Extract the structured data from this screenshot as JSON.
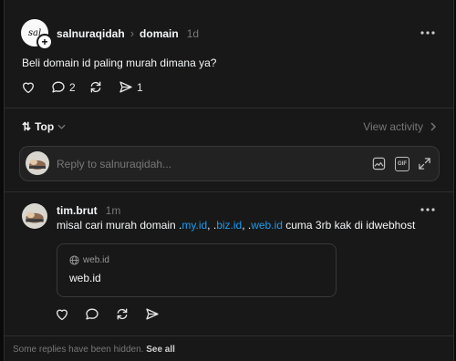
{
  "post": {
    "username": "salnuraqidah",
    "topic_separator": "›",
    "topic": "domain",
    "time": "1d",
    "text": "Beli domain id paling murah dimana ya?",
    "replies_count": "2",
    "shares_count": "1",
    "avatar_text": "sal"
  },
  "sort": {
    "label": "Top",
    "view_activity": "View activity"
  },
  "reply_box": {
    "placeholder": "Reply to salnuraqidah..."
  },
  "reply": {
    "username": "tim.brut",
    "time": "1m",
    "text_parts": {
      "p1": "misal cari murah domain .",
      "link1": "my.id",
      "p2": ", .",
      "link2": "biz.id",
      "p3": ", .",
      "link3": "web.id",
      "p4": " cuma 3rb kak di idwebhost"
    },
    "link_card": {
      "domain": "web.id",
      "title": "web.id"
    }
  },
  "footer": {
    "hidden_text": "Some replies have been hidden.",
    "see_all": "See all"
  },
  "colors": {
    "background": "#181818",
    "link": "#1d9bf0",
    "muted": "#777777"
  }
}
